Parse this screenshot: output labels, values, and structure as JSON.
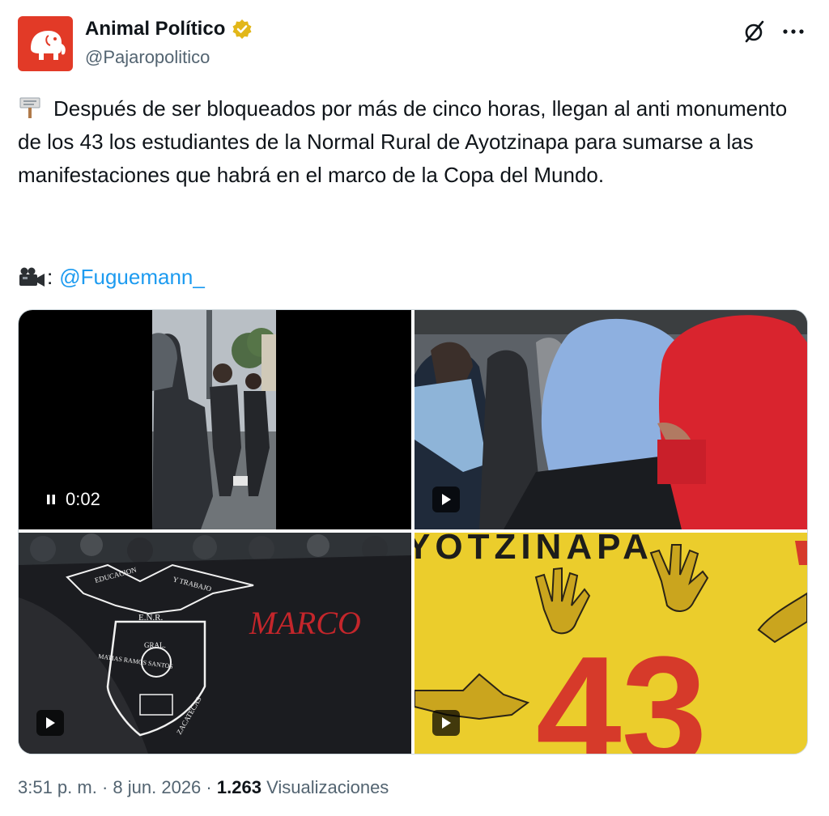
{
  "author": {
    "name": "Animal Político",
    "handle": "@Pajaropolitico"
  },
  "tweet": {
    "text": "Después de ser bloqueados por más de cinco horas, llegan al anti monumento de los 43 los estudiantes de la Normal Rural de Ayotzinapa para sumarse a las manifestaciones que habrá en el marco de la Copa del Mundo.",
    "credit_separator": ":",
    "credit_mention": "@Fuguemann_",
    "icons": {
      "lead": "signpost-icon",
      "credit": "video-camera-icon"
    }
  },
  "media": {
    "video_time": "0:02",
    "banner_left_text": "MARCO",
    "banner_right_text": "YOTZINAPA",
    "banner_number": "43",
    "emblem_lines": [
      "EDUCACION",
      "Y TRABAJO",
      "E.N.R.",
      "GRAL.",
      "MATIAS RAMOS SANTOS",
      "ZACATECAS"
    ]
  },
  "meta": {
    "time": "3:51 p. m.",
    "dot1": "·",
    "date": "8 jun. 2026",
    "dot2": "·",
    "views_count": "1.263",
    "views_label": "Visualizaciones"
  },
  "colors": {
    "brand_red": "#e23a27",
    "link_blue": "#1d9bf0",
    "verified_gold": "#e2b719",
    "muted": "#536471"
  }
}
